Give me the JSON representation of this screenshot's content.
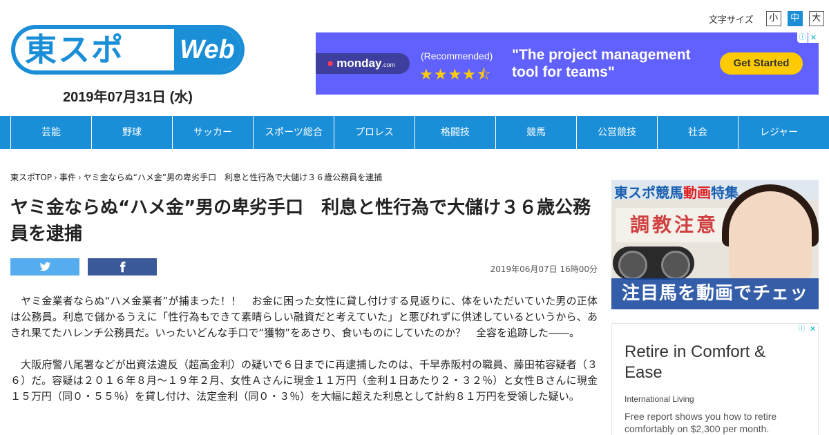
{
  "logo": {
    "jp": "東スポ",
    "web": "Web"
  },
  "header": {
    "date": "2019年07月31日 (水)"
  },
  "font_size": {
    "label": "文字サイズ",
    "options": [
      "小",
      "中",
      "大"
    ],
    "selected": "中"
  },
  "top_ad": {
    "brand": "monday",
    "brand_suffix": ".com",
    "recommended": "(Recommended)",
    "stars": "★★★★⯪",
    "headline": "\"The project management tool for teams\"",
    "cta": "Get Started",
    "info": "ⓘ",
    "close": "✕"
  },
  "nav": {
    "items": [
      "芸能",
      "野球",
      "サッカー",
      "スポーツ総合",
      "プロレス",
      "格闘技",
      "競馬",
      "公営競技",
      "社会",
      "レジャー"
    ]
  },
  "breadcrumb": {
    "items": [
      "東スポTOP",
      "事件",
      "ヤミ金ならぬ“ハメ金”男の卑劣手口　利息と性行為で大儲け３６歳公務員を逮捕"
    ],
    "separator": "›"
  },
  "article": {
    "title": "ヤミ金ならぬ“ハメ金”男の卑劣手口　利息と性行為で大儲け３６歳公務員を逮捕",
    "published": "2019年06月07日 16時00分",
    "paragraphs": [
      "ヤミ金業者ならぬ“ハメ金業者”が捕まった！！　お金に困った女性に貸し付けする見返りに、体をいただいていた男の正体は公務員。利息で儲かるうえに「性行為もできて素晴らしい融資だと考えていた」と悪びれずに供述しているというから、あきれ果てたハレンチ公務員だ。いったいどんな手口で“獲物”をあさり、食いものにしていたのか？　全容を追跡した――。",
      "大阪府警八尾署などが出資法違反（超高金利）の疑いで６日までに再逮捕したのは、千早赤阪村の職員、藤田祐容疑者（３６）だ。容疑は２０１６年８月～１９年２月、女性Ａさんに現金１１万円（金利１日あたり２・３２％）と女性Ｂさんに現金１５万円（同０・５５％）を貸し付け、法定金利（同０・３％）を大幅に超えた利息として計約８１万円を受領した疑い。"
    ]
  },
  "share": {
    "twitter_icon": "twitter-icon",
    "facebook_icon": "facebook-icon"
  },
  "sidebar": {
    "banner": {
      "top_prefix": "東スポ競馬",
      "top_highlight": "動画",
      "top_suffix": "特集",
      "sign": "調教注意",
      "bottom": "注目馬を動画でチェック！"
    },
    "ad": {
      "title": "Retire in Comfort & Ease",
      "brand": "International Living",
      "desc": "Free report shows you how to retire comfortably on $2,300 per month.",
      "info": "ⓘ",
      "close": "✕"
    }
  },
  "colors": {
    "brand_blue": "#1a8fd8",
    "twitter": "#55acee",
    "facebook": "#3b5998",
    "monday_bg": "#6161ff"
  }
}
